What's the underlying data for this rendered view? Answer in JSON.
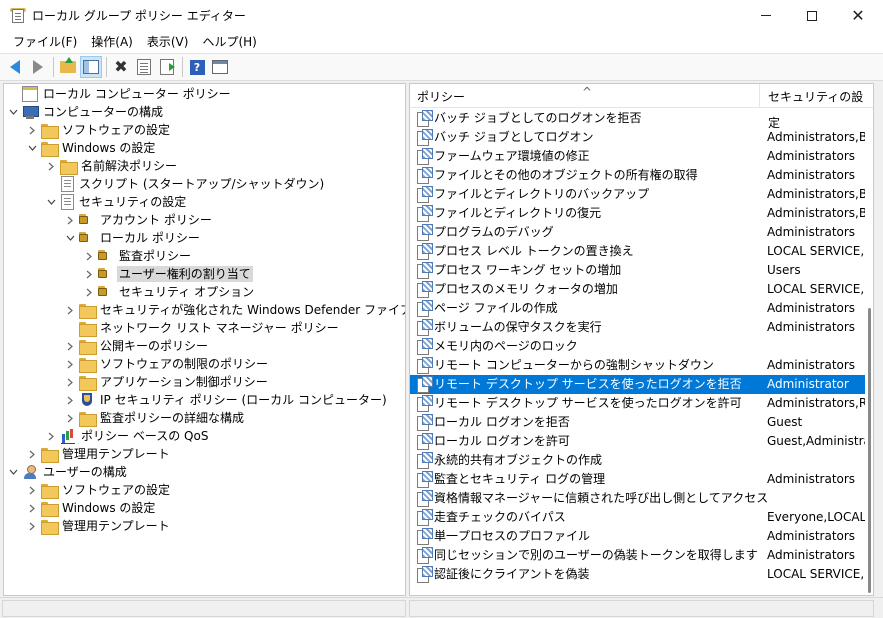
{
  "window": {
    "title": "ローカル グループ ポリシー エディター",
    "minimize_glyph": "—",
    "maximize_glyph": "☐",
    "close_glyph": "✕"
  },
  "menu": [
    "ファイル(F)",
    "操作(A)",
    "表示(V)",
    "ヘルプ(H)"
  ],
  "toolbar": {
    "icons": [
      "back-arrow-icon",
      "forward-arrow-icon",
      "up-folder-icon",
      "show-hide-tree-icon",
      "delete-icon",
      "properties-icon",
      "export-list-icon",
      "help-icon",
      "view-icon"
    ],
    "help_glyph": "?"
  },
  "tree": [
    {
      "label": "ローカル コンピューター ポリシー",
      "level": 0,
      "twisty": "",
      "icon": "policy"
    },
    {
      "label": "コンピューターの構成",
      "level": 0,
      "twisty": "open",
      "icon": "computer"
    },
    {
      "label": "ソフトウェアの設定",
      "level": 1,
      "twisty": "closed",
      "icon": "folder"
    },
    {
      "label": "Windows の設定",
      "level": 1,
      "twisty": "open",
      "icon": "folder"
    },
    {
      "label": "名前解決ポリシー",
      "level": 2,
      "twisty": "closed",
      "icon": "folder"
    },
    {
      "label": "スクリプト (スタートアップ/シャットダウン)",
      "level": 2,
      "twisty": "",
      "icon": "doc"
    },
    {
      "label": "セキュリティの設定",
      "level": 2,
      "twisty": "open",
      "icon": "doc"
    },
    {
      "label": "アカウント ポリシー",
      "level": 3,
      "twisty": "closed",
      "icon": "lockfolder"
    },
    {
      "label": "ローカル ポリシー",
      "level": 3,
      "twisty": "open",
      "icon": "lockfolder"
    },
    {
      "label": "監査ポリシー",
      "level": 4,
      "twisty": "closed",
      "icon": "lockfolder"
    },
    {
      "label": "ユーザー権利の割り当て",
      "level": 4,
      "twisty": "closed",
      "icon": "lockfolder",
      "selected": true
    },
    {
      "label": "セキュリティ オプション",
      "level": 4,
      "twisty": "closed",
      "icon": "lockfolder"
    },
    {
      "label": "セキュリティが強化された Windows Defender ファイアウォール",
      "level": 3,
      "twisty": "closed",
      "icon": "folder"
    },
    {
      "label": "ネットワーク リスト マネージャー ポリシー",
      "level": 3,
      "twisty": "",
      "icon": "folder"
    },
    {
      "label": "公開キーのポリシー",
      "level": 3,
      "twisty": "closed",
      "icon": "folder"
    },
    {
      "label": "ソフトウェアの制限のポリシー",
      "level": 3,
      "twisty": "closed",
      "icon": "folder"
    },
    {
      "label": "アプリケーション制御ポリシー",
      "level": 3,
      "twisty": "closed",
      "icon": "folder"
    },
    {
      "label": "IP セキュリティ ポリシー (ローカル コンピューター)",
      "level": 3,
      "twisty": "closed",
      "icon": "shield"
    },
    {
      "label": "監査ポリシーの詳細な構成",
      "level": 3,
      "twisty": "closed",
      "icon": "folder"
    },
    {
      "label": "ポリシー ベースの QoS",
      "level": 2,
      "twisty": "closed",
      "icon": "chart"
    },
    {
      "label": "管理用テンプレート",
      "level": 1,
      "twisty": "closed",
      "icon": "folder"
    },
    {
      "label": "ユーザーの構成",
      "level": 0,
      "twisty": "open",
      "icon": "user"
    },
    {
      "label": "ソフトウェアの設定",
      "level": 1,
      "twisty": "closed",
      "icon": "folder"
    },
    {
      "label": "Windows の設定",
      "level": 1,
      "twisty": "closed",
      "icon": "folder"
    },
    {
      "label": "管理用テンプレート",
      "level": 1,
      "twisty": "closed",
      "icon": "folder"
    }
  ],
  "list": {
    "columns": [
      "ポリシー",
      "セキュリティの設定"
    ],
    "sort_glyph": "^",
    "rows": [
      {
        "name": "バッチ ジョブとしてのログオンを拒否",
        "value": ""
      },
      {
        "name": "バッチ ジョブとしてログオン",
        "value": "Administrators,Bac"
      },
      {
        "name": "ファームウェア環境値の修正",
        "value": "Administrators"
      },
      {
        "name": "ファイルとその他のオブジェクトの所有権の取得",
        "value": "Administrators"
      },
      {
        "name": "ファイルとディレクトリのバックアップ",
        "value": "Administrators,Bac"
      },
      {
        "name": "ファイルとディレクトリの復元",
        "value": "Administrators,Bac"
      },
      {
        "name": "プログラムのデバッグ",
        "value": "Administrators"
      },
      {
        "name": "プロセス レベル トークンの置き換え",
        "value": "LOCAL SERVICE,NE"
      },
      {
        "name": "プロセス ワーキング セットの増加",
        "value": "Users"
      },
      {
        "name": "プロセスのメモリ クォータの増加",
        "value": "LOCAL SERVICE,NE"
      },
      {
        "name": "ページ ファイルの作成",
        "value": "Administrators"
      },
      {
        "name": "ボリュームの保守タスクを実行",
        "value": "Administrators"
      },
      {
        "name": "メモリ内のページのロック",
        "value": ""
      },
      {
        "name": "リモート コンピューターからの強制シャットダウン",
        "value": "Administrators"
      },
      {
        "name": "リモート デスクトップ サービスを使ったログオンを拒否",
        "value": "Administrator",
        "selected": true
      },
      {
        "name": "リモート デスクトップ サービスを使ったログオンを許可",
        "value": "Administrators,Ren"
      },
      {
        "name": "ローカル ログオンを拒否",
        "value": "Guest"
      },
      {
        "name": "ローカル ログオンを許可",
        "value": "Guest,Administrato"
      },
      {
        "name": "永続的共有オブジェクトの作成",
        "value": ""
      },
      {
        "name": "監査とセキュリティ ログの管理",
        "value": "Administrators"
      },
      {
        "name": "資格情報マネージャーに信頼された呼び出し側としてアクセス",
        "value": ""
      },
      {
        "name": "走査チェックのバイパス",
        "value": "Everyone,LOCAL S"
      },
      {
        "name": "単一プロセスのプロファイル",
        "value": "Administrators"
      },
      {
        "name": "同じセッションで別のユーザーの偽装トークンを取得します",
        "value": "Administrators"
      },
      {
        "name": "認証後にクライアントを偽装",
        "value": "LOCAL SERVICE,NE"
      }
    ]
  },
  "colors": {
    "selection": "#0078d7",
    "tree_selection": "#d9d9d9",
    "pane_bg": "#ffffff",
    "chrome_bg": "#f0f0f0"
  }
}
